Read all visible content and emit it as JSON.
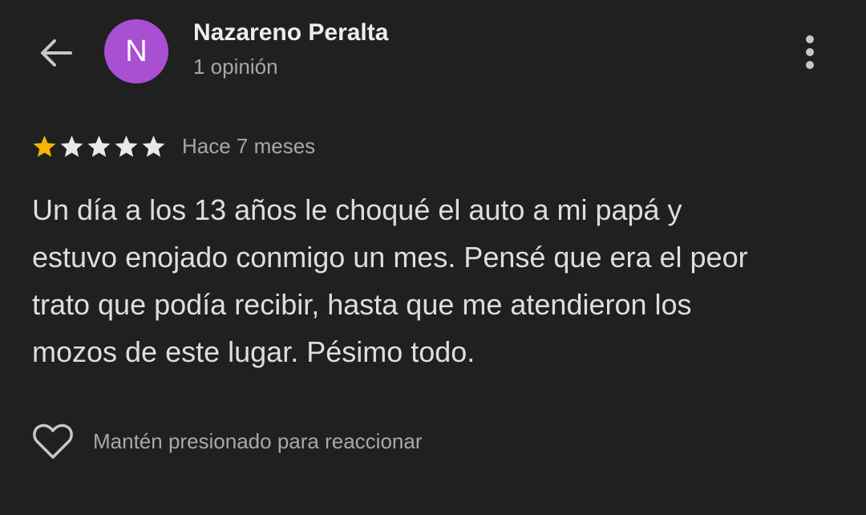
{
  "header": {
    "avatar_initial": "N",
    "author_name": "Nazareno Peralta",
    "review_count": "1 opinión",
    "avatar_color": "#a94fd1"
  },
  "review": {
    "rating": 1,
    "max_rating": 5,
    "time_ago": "Hace 7 meses",
    "text": "Un día a los 13 años le choqué el auto a mi papá y\nestuvo enojado conmigo un mes. Pensé que era el peor\ntrato que podía recibir, hasta que me atendieron los\nmozos de este lugar. Pésimo todo.",
    "star_filled_color": "#f4b400",
    "star_empty_color": "#e8e8e8"
  },
  "reactions": {
    "hint": "Mantén presionado para reaccionar"
  },
  "icons": {
    "back": "arrow-left-icon",
    "more": "more-vertical-icon",
    "heart": "heart-outline-icon",
    "star": "star-icon"
  }
}
